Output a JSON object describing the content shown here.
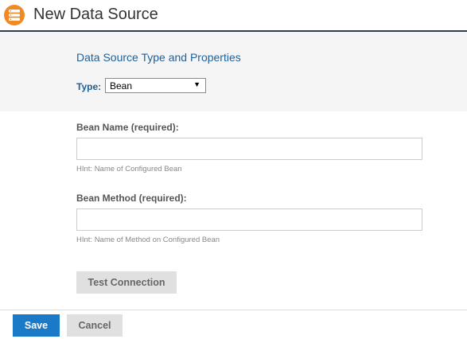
{
  "header": {
    "title": "New Data Source",
    "icon": "database-icon",
    "icon_color": "#f08a24",
    "rule_color": "#2d3e50"
  },
  "section": {
    "heading": "Data Source Type and Properties",
    "type_label": "Type:",
    "type_value": "Bean"
  },
  "fields": [
    {
      "label": "Bean Name (required):",
      "value": "",
      "hint": "HInt: Name of Configured Bean"
    },
    {
      "label": "Bean Method (required):",
      "value": "",
      "hint": "HInt: Name of Method on Configured Bean"
    }
  ],
  "buttons": {
    "test": "Test Connection",
    "save": "Save",
    "cancel": "Cancel"
  },
  "colors": {
    "accent": "#1a7ac7",
    "heading": "#1f5f99"
  }
}
